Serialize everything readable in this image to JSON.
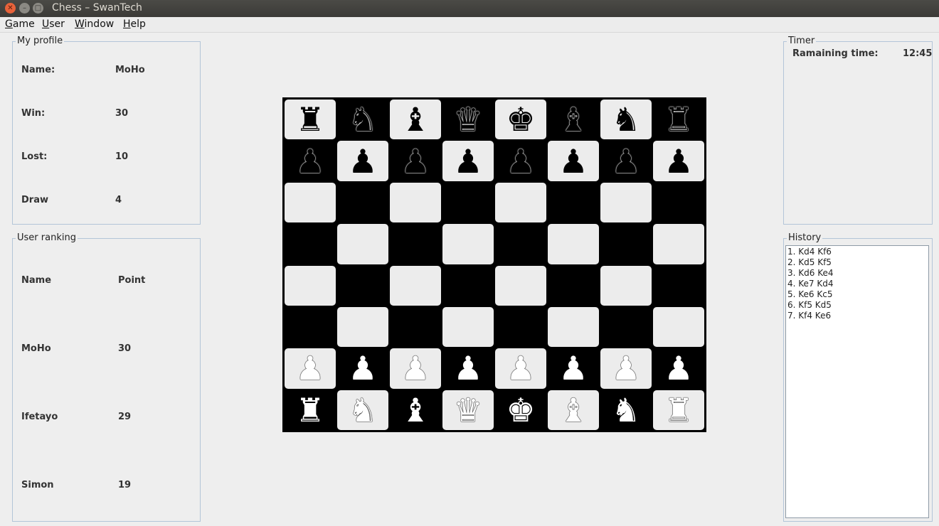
{
  "window": {
    "title": "Chess – SwanTech"
  },
  "menu": [
    {
      "mnemonic": "G",
      "rest": "ame"
    },
    {
      "mnemonic": "U",
      "rest": "ser"
    },
    {
      "mnemonic": "W",
      "rest": "indow"
    },
    {
      "mnemonic": "H",
      "rest": "elp"
    }
  ],
  "profile": {
    "title": "My profile",
    "rows": [
      {
        "label": "Name:",
        "value": "MoHo"
      },
      {
        "label": "Win:",
        "value": "30"
      },
      {
        "label": "Lost:",
        "value": "10"
      },
      {
        "label": "Draw",
        "value": "4"
      }
    ]
  },
  "ranking": {
    "title": "User ranking",
    "header": {
      "name": "Name",
      "point": "Point"
    },
    "rows": [
      {
        "name": "MoHo",
        "point": "30"
      },
      {
        "name": "Ifetayo",
        "point": "29"
      },
      {
        "name": "Simon",
        "point": "19"
      }
    ]
  },
  "timer": {
    "title": "Timer",
    "label": "Ramaining time:",
    "value": "12:45"
  },
  "history": {
    "title": "History",
    "moves": [
      "1. Kd4 Kf6",
      "2. Kd5 Kf5",
      "3. Kd6 Ke4",
      "4. Ke7 Kd4",
      "5. Ke6 Kc5",
      "6. Kf5 Kd5",
      "7. Kf4 Ke6"
    ]
  },
  "board": {
    "rows": [
      [
        "♜",
        "♞",
        "♝",
        "♛",
        "♚",
        "♝",
        "♞",
        "♜"
      ],
      [
        "♟",
        "♟",
        "♟",
        "♟",
        "♟",
        "♟",
        "♟",
        "♟"
      ],
      [
        "",
        "",
        "",
        "",
        "",
        "",
        "",
        ""
      ],
      [
        "",
        "",
        "",
        "",
        "",
        "",
        "",
        ""
      ],
      [
        "",
        "",
        "",
        "",
        "",
        "",
        "",
        ""
      ],
      [
        "",
        "",
        "",
        "",
        "",
        "",
        "",
        ""
      ],
      [
        "♙",
        "♙",
        "♙",
        "♙",
        "♙",
        "♙",
        "♙",
        "♙"
      ],
      [
        "♖",
        "♘",
        "♗",
        "♕",
        "♔",
        "♗",
        "♘",
        "♖"
      ]
    ]
  }
}
